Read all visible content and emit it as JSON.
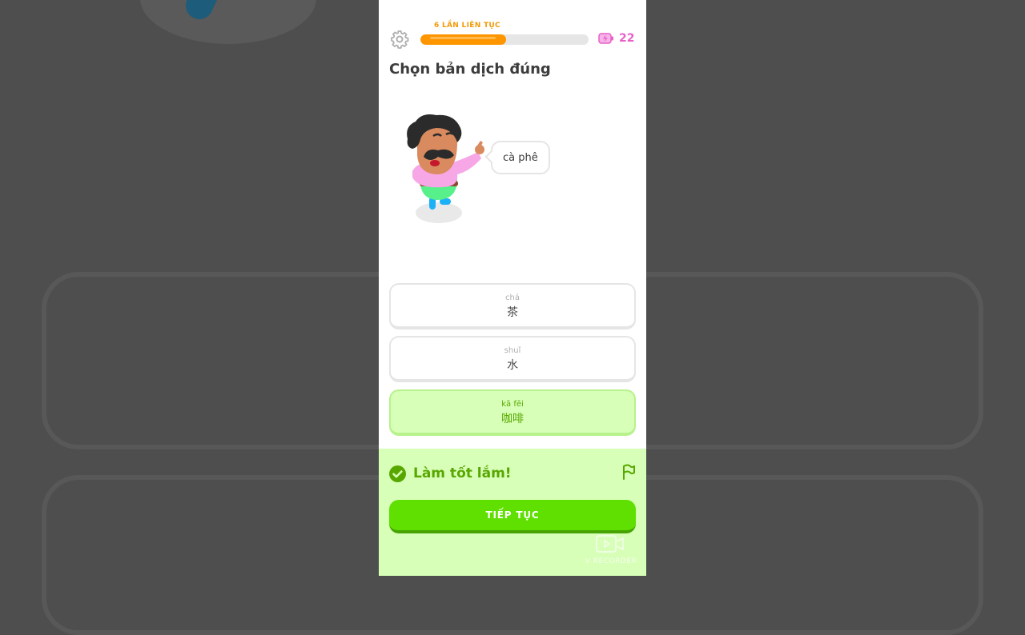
{
  "header": {
    "settings_icon": "gear-icon",
    "streak_label": "6 LẦN LIÊN TỤC",
    "progress_fraction": 0.51,
    "energy_icon": "battery-bolt-icon",
    "energy_count": "22"
  },
  "prompt": {
    "title": "Chọn bản dịch đúng",
    "speech_bubble": "cà phê"
  },
  "options": [
    {
      "pinyin": "chá",
      "hanzi": "茶",
      "state": "default"
    },
    {
      "pinyin": "shuǐ",
      "hanzi": "水",
      "state": "default"
    },
    {
      "pinyin": "kā fēi",
      "hanzi": "咖啡",
      "state": "correct"
    }
  ],
  "feedback": {
    "icon": "check-circle-icon",
    "message": "Làm tốt lắm!",
    "flag_icon": "flag-icon",
    "continue_label": "TIẾP TỤC"
  },
  "watermark": {
    "icon": "video-camera-icon",
    "text": "V RECORDER"
  },
  "colors": {
    "streak_orange": "#ff9600",
    "energy_pink": "#e85fc9",
    "correct_bg": "#d7ffb8",
    "correct_text": "#58a700",
    "button_green": "#5fe000"
  }
}
